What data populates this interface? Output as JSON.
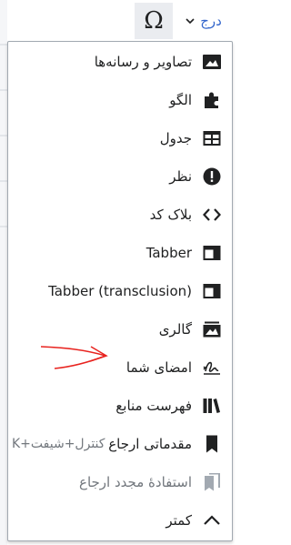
{
  "toolbar": {
    "special_char_symbol": "Ω",
    "insert_label": "درج",
    "accent_color": "#3366cc"
  },
  "menu": {
    "items": [
      {
        "label": "تصاویر و رسانه‌ها",
        "icon": "image-icon"
      },
      {
        "label": "الگو",
        "icon": "puzzle-icon"
      },
      {
        "label": "جدول",
        "icon": "table-icon"
      },
      {
        "label": "نظر",
        "icon": "alert-icon"
      },
      {
        "label": "بلاک کد",
        "icon": "code-icon"
      },
      {
        "label": "Tabber",
        "icon": "tabber-icon"
      },
      {
        "label": "Tabber (transclusion)",
        "icon": "tabber-icon"
      },
      {
        "label": "گالری",
        "icon": "gallery-icon"
      },
      {
        "label": "امضای شما",
        "icon": "signature-icon",
        "highlighted": true,
        "highlight_color": "#f3f03c"
      },
      {
        "label": "فهرست منابع",
        "icon": "references-icon"
      },
      {
        "label": "مقدماتی ارجاع",
        "icon": "cite-icon",
        "shortcut": "K+کنترل+شیفت"
      },
      {
        "label": "استفادهٔ مجدد ارجاع",
        "icon": "reuse-cite-icon",
        "disabled": true
      },
      {
        "label": "کمتر",
        "icon": "chevron-up-icon"
      }
    ]
  },
  "annotation": {
    "color": "#e8231f",
    "icon": "red-arrow-annotation"
  }
}
